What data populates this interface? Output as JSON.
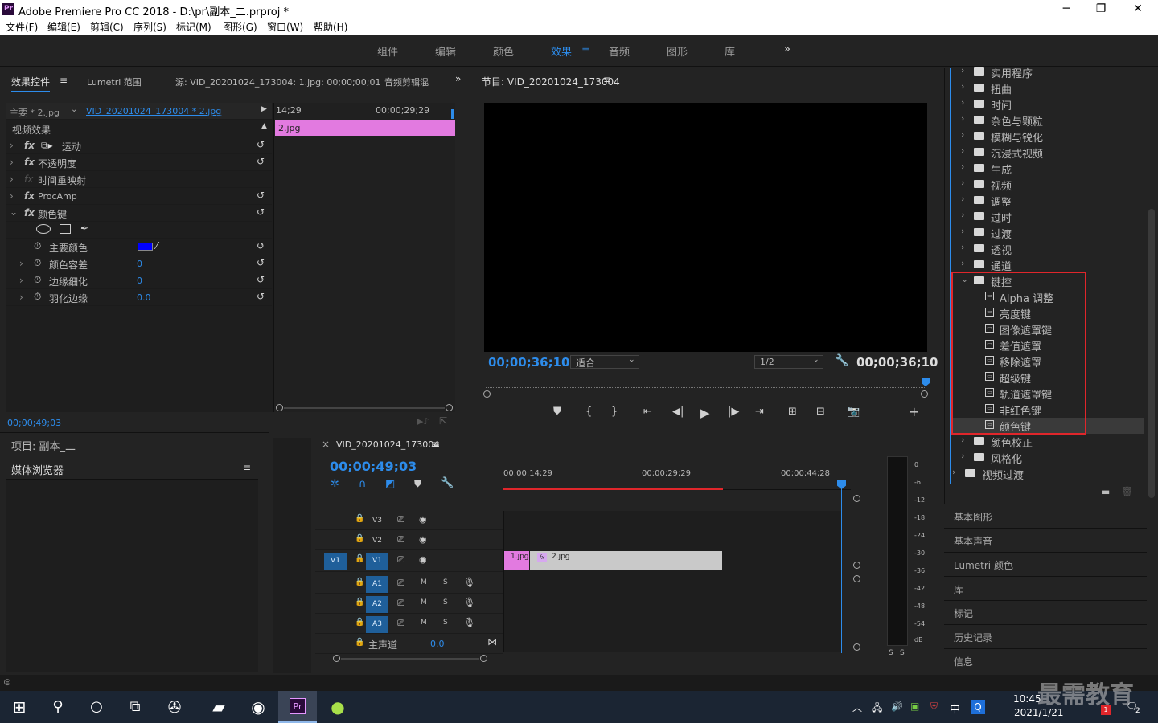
{
  "window": {
    "app_icon": "Pr",
    "title": "Adobe Premiere Pro CC 2018 - D:\\pr\\副本_二.prproj *",
    "minimize": "─",
    "restore": "❐",
    "close": "✕"
  },
  "menu": [
    "文件(F)",
    "编辑(E)",
    "剪辑(C)",
    "序列(S)",
    "标记(M)",
    "图形(G)",
    "窗口(W)",
    "帮助(H)"
  ],
  "workspaces": [
    "组件",
    "编辑",
    "颜色",
    "效果",
    "音频",
    "图形",
    "库"
  ],
  "workspace_active": "效果",
  "workspace_menu_icon": "≡",
  "workspace_more": "»",
  "effect_controls": {
    "tabs": [
      "效果控件",
      "Lumetri 范围",
      "源: VID_20201024_173004: 1.jpg: 00;00;00;01",
      "音频剪辑混"
    ],
    "menu_icon": "≡",
    "more": "»",
    "master": "主要 * 2.jpg",
    "clip": "VID_20201024_173004 * 2.jpg",
    "tl_time1": "14;29",
    "tl_time2": "00;00;29;29",
    "clip_label": "2.jpg",
    "section": "视频效果",
    "effects": [
      "运动",
      "不透明度",
      "时间重映射",
      "ProcAmp",
      "颜色键"
    ],
    "params": [
      {
        "name": "主要颜色",
        "value": ""
      },
      {
        "name": "颜色容差",
        "value": "0"
      },
      {
        "name": "边缘细化",
        "value": "0"
      },
      {
        "name": "羽化边缘",
        "value": "0.0"
      }
    ],
    "timecode": "00;00;49;03",
    "key_color": "#0000ff"
  },
  "program": {
    "title": "节目: VID_20201024_173004",
    "menu_icon": "≡",
    "timecode_left": "00;00;36;10",
    "fit": "适合",
    "resolution": "1/2",
    "timecode_right": "00;00;36;10",
    "add": "+"
  },
  "project": {
    "title": "项目: 副本_二",
    "media_browser": "媒体浏览器",
    "menu_icon": "≡"
  },
  "timeline": {
    "close": "×",
    "title": "VID_20201024_173004",
    "menu_icon": "≡",
    "timecode": "00;00;49;03",
    "ruler": [
      "00;00;14;29",
      "00;00;29;29",
      "00;00;44;28"
    ],
    "video_tracks": [
      "V3",
      "V2",
      "V1"
    ],
    "audio_tracks": [
      "A1",
      "A2",
      "A3"
    ],
    "source_patch": "V1",
    "mute": "M",
    "solo": "S",
    "master": "主声道",
    "master_value": "0.0",
    "clip1": "1.jpg",
    "clip2": "2.jpg",
    "fx": "fx"
  },
  "meter": {
    "labels": [
      "0",
      "-6",
      "-12",
      "-18",
      "-24",
      "-30",
      "-36",
      "-42",
      "-48",
      "-54",
      "dB"
    ],
    "solo": [
      "S",
      "S"
    ]
  },
  "effects_tree": {
    "items_above": [
      "实用程序",
      "扭曲",
      "时间",
      "杂色与颗粒",
      "模糊与锐化",
      "沉浸式视频",
      "生成",
      "视频",
      "调整",
      "过时",
      "过渡",
      "透视",
      "通道"
    ],
    "expanded": "键控",
    "keying_items": [
      "Alpha 调整",
      "亮度键",
      "图像遮罩键",
      "差值遮罩",
      "移除遮罩",
      "超级键",
      "轨道遮罩键",
      "非红色键",
      "颜色键"
    ],
    "items_below": [
      "颜色校正",
      "风格化"
    ],
    "video_transitions": "视频过渡",
    "selected": "颜色键"
  },
  "side_panels": [
    "基本图形",
    "基本声音",
    "Lumetri 颜色",
    "库",
    "标记",
    "历史记录",
    "信息"
  ],
  "taskbar": {
    "time": "10:45",
    "date": "2021/1/21",
    "ime": "中",
    "watermark": "最需教育",
    "badge1": "1",
    "badge2": "2"
  },
  "colors": {
    "accent": "#2d8ceb",
    "clip_pink": "#e27ae0",
    "highlight_red": "#e0262b"
  }
}
